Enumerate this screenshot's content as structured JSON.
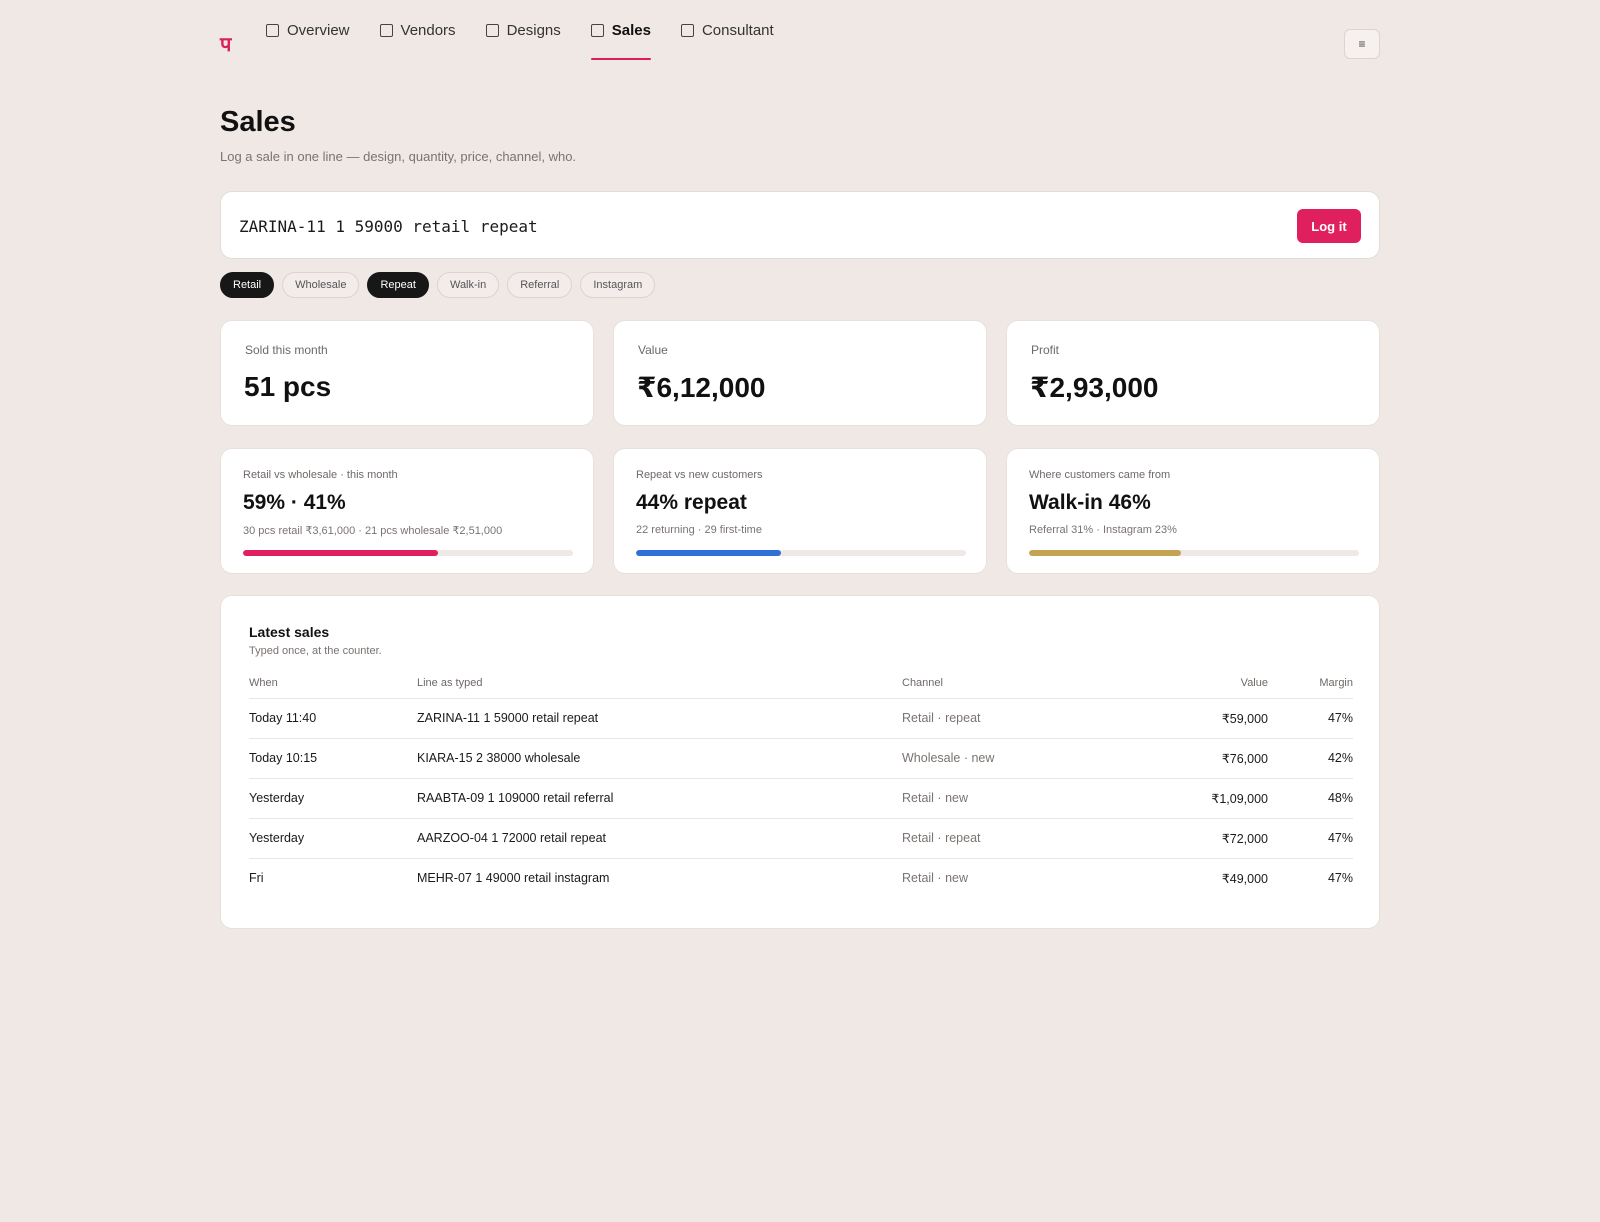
{
  "brand": {
    "logo": "प"
  },
  "nav": {
    "tabs": [
      {
        "label": "Overview"
      },
      {
        "label": "Vendors"
      },
      {
        "label": "Designs"
      },
      {
        "label": "Sales"
      },
      {
        "label": "Consultant"
      }
    ],
    "active": "Sales",
    "menu_icon": "≡"
  },
  "page": {
    "title": "Sales",
    "subtitle": "Log a sale in one line — design, quantity, price, channel, who."
  },
  "entry": {
    "value": "ZARINA-11 1 59000 retail repeat",
    "button": "Log it"
  },
  "chips": [
    {
      "label": "Retail",
      "selected": true
    },
    {
      "label": "Wholesale",
      "selected": false
    },
    {
      "label": "Repeat",
      "selected": true
    },
    {
      "label": "Walk-in",
      "selected": false
    },
    {
      "label": "Referral",
      "selected": false
    },
    {
      "label": "Instagram",
      "selected": false
    }
  ],
  "stats": [
    {
      "label": "Sold this month",
      "value": "51 pcs"
    },
    {
      "label": "Value",
      "value": "₹6,12,000"
    },
    {
      "label": "Profit",
      "value": "₹2,93,000"
    }
  ],
  "mix": [
    {
      "label": "Retail vs wholesale · this month",
      "value": "59% · 41%",
      "detail": "30 pcs retail ₹3,61,000 · 21 pcs wholesale ₹2,51,000",
      "progress": 0.59,
      "color": "#e01f5e"
    },
    {
      "label": "Repeat vs new customers",
      "value": "44% repeat",
      "detail": "22 returning · 29 first-time",
      "progress": 0.44,
      "color": "#2f6fd6"
    },
    {
      "label": "Where customers came from",
      "value": "Walk-in 46%",
      "detail": "Referral 31% · Instagram 23%",
      "progress": 0.46,
      "color": "#c4a452"
    }
  ],
  "latest": {
    "title": "Latest sales",
    "subtitle": "Typed once, at the counter.",
    "columns": [
      "When",
      "Line as typed",
      "Channel",
      "Value",
      "Margin"
    ],
    "rows": [
      {
        "when": "Today 11:40",
        "line": "ZARINA-11 1 59000 retail repeat",
        "channel": "Retail · repeat",
        "value": "₹59,000",
        "margin": "47%"
      },
      {
        "when": "Today 10:15",
        "line": "KIARA-15 2 38000 wholesale",
        "channel": "Wholesale · new",
        "value": "₹76,000",
        "margin": "42%"
      },
      {
        "when": "Yesterday",
        "line": "RAABTA-09 1 109000 retail referral",
        "channel": "Retail · new",
        "value": "₹1,09,000",
        "margin": "48%"
      },
      {
        "when": "Yesterday",
        "line": "AARZOO-04 1 72000 retail repeat",
        "channel": "Retail · repeat",
        "value": "₹72,000",
        "margin": "47%"
      },
      {
        "when": "Fri",
        "line": "MEHR-07 1 49000 retail instagram",
        "channel": "Retail · new",
        "value": "₹49,000",
        "margin": "47%"
      }
    ]
  }
}
